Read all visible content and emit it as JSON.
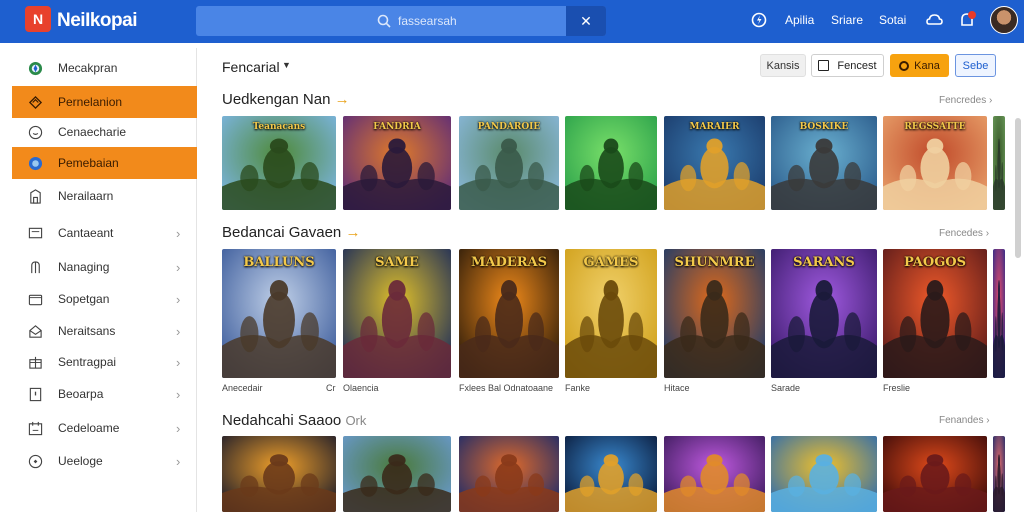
{
  "app": {
    "title": "NeiIkopai",
    "logo_letter": "N"
  },
  "search": {
    "placeholder": "fassearsah"
  },
  "header": {
    "links": [
      "Apilia",
      "Sriare",
      "Sotai"
    ]
  },
  "sidebar": {
    "items": [
      {
        "label": "Mecakpran",
        "icon": "compass-icon",
        "active": false,
        "chevron": false
      },
      {
        "label": "Pernelanion",
        "icon": "fire-icon",
        "active": true,
        "chevron": false
      },
      {
        "label": "Cenaecharie",
        "icon": "clock-icon",
        "active": false,
        "chevron": false
      },
      {
        "label": "Pemebaian",
        "icon": "globe-icon",
        "active": true,
        "chevron": false
      },
      {
        "label": "Nerailaarn",
        "icon": "building-icon",
        "active": false,
        "chevron": false
      },
      {
        "label": "Cantaeant",
        "icon": "monitor-icon",
        "active": false,
        "chevron": true
      },
      {
        "label": "Nanaging",
        "icon": "hand-icon",
        "active": false,
        "chevron": true
      },
      {
        "label": "Sopetgan",
        "icon": "folder-icon",
        "active": false,
        "chevron": true
      },
      {
        "label": "Neraitsans",
        "icon": "mail-icon",
        "active": false,
        "chevron": true
      },
      {
        "label": "Sentragpai",
        "icon": "gift-icon",
        "active": false,
        "chevron": true
      },
      {
        "label": "Beoarpa",
        "icon": "card-icon",
        "active": false,
        "chevron": true
      },
      {
        "label": "Cedeloame",
        "icon": "calendar-icon",
        "active": false,
        "chevron": true
      },
      {
        "label": "Ueeloge",
        "icon": "settings-icon",
        "active": false,
        "chevron": true
      }
    ]
  },
  "toolbar": {
    "filter_label": "Fencarial",
    "buttons": [
      "Kansis",
      "Fencest",
      "Kana",
      "Sebe"
    ]
  },
  "sections": [
    {
      "title": "Uedkengan Nan",
      "more": "Fencredes"
    },
    {
      "title": "Bedancai Gavaen",
      "more": "Fencedes"
    },
    {
      "title": "Nedahcahi Saaoo",
      "title_suffix": "Ork",
      "more": "Fenandes"
    }
  ],
  "row1_tiles": [
    {
      "title": "Teanacans",
      "colors": [
        "#7db6e6",
        "#4f8a3a",
        "#2a4a1c"
      ]
    },
    {
      "title": "FANDRIA",
      "colors": [
        "#5a2a7a",
        "#e07a2a",
        "#2a1a3a"
      ]
    },
    {
      "title": "PANDAROIE",
      "colors": [
        "#8ab8dc",
        "#5a8a6a",
        "#3a5a4a"
      ]
    },
    {
      "title": "",
      "colors": [
        "#2aa04a",
        "#7ae06a",
        "#1a4a1a"
      ]
    },
    {
      "title": "MARAIER",
      "colors": [
        "#1a3a6a",
        "#3a7ab0",
        "#e0a02a"
      ]
    },
    {
      "title": "BOSKIKE",
      "colors": [
        "#2a5a8a",
        "#6ab0d0",
        "#3a3a3a"
      ]
    },
    {
      "title": "REGSSATTE",
      "colors": [
        "#e8a06a",
        "#c04a2a",
        "#f0d0a0"
      ]
    },
    {
      "title": "",
      "colors": [
        "#6a9a5a",
        "#3a5a2a",
        "#2a3a2a"
      ]
    }
  ],
  "row2_tiles": [
    {
      "title": "BALLUNS",
      "caption": "Anecedair",
      "caption2": "Cr",
      "colors": [
        "#3a5a9a",
        "#c0d0e8",
        "#4a3a2a"
      ]
    },
    {
      "title": "SAME",
      "caption": "Olaencia",
      "colors": [
        "#1a2a5a",
        "#e0c02a",
        "#6a2a3a"
      ]
    },
    {
      "title": "MADERAS",
      "caption": "Fxlees Bal Odnatoaane",
      "colors": [
        "#2a1a0a",
        "#f08a1a",
        "#4a2a1a"
      ]
    },
    {
      "title": "GAMES",
      "caption": "Fanke",
      "colors": [
        "#d0a01a",
        "#f0d06a",
        "#6a4a0a"
      ]
    },
    {
      "title": "SHUNMRE",
      "caption": "Hitace",
      "colors": [
        "#1a3a6a",
        "#e06a1a",
        "#3a2a1a"
      ]
    },
    {
      "title": "SARANS",
      "caption": "Sarade",
      "colors": [
        "#3a1a6a",
        "#a05ae0",
        "#1a1a3a"
      ]
    },
    {
      "title": "PAOGOS",
      "caption": "Freslie",
      "colors": [
        "#5a1a1a",
        "#f05a2a",
        "#2a1a1a"
      ]
    },
    {
      "title": "",
      "caption": "",
      "colors": [
        "#2a2a8a",
        "#e04a6a",
        "#1a1a3a"
      ]
    }
  ],
  "row3_tiles": [
    {
      "colors": [
        "#1a1a2a",
        "#f0a02a",
        "#6a3a1a"
      ]
    },
    {
      "colors": [
        "#6a9ad0",
        "#4a7a3a",
        "#3a2a1a"
      ]
    },
    {
      "colors": [
        "#1a2a6a",
        "#e06a2a",
        "#8a3a1a"
      ]
    },
    {
      "colors": [
        "#0a1a3a",
        "#3a8ad0",
        "#e0a02a"
      ]
    },
    {
      "colors": [
        "#3a1a5a",
        "#c05ae0",
        "#e08a2a"
      ]
    },
    {
      "colors": [
        "#2a6ab0",
        "#f0c02a",
        "#5ab0e0"
      ]
    },
    {
      "colors": [
        "#3a0a0a",
        "#e04a1a",
        "#6a1a1a"
      ]
    },
    {
      "colors": [
        "#1a2a6a",
        "#e06a6a",
        "#2a1a2a"
      ]
    }
  ],
  "colors": {
    "topbar": "#1e5fcf",
    "accent": "#f28a1b",
    "orange_button": "#f7a20f"
  }
}
